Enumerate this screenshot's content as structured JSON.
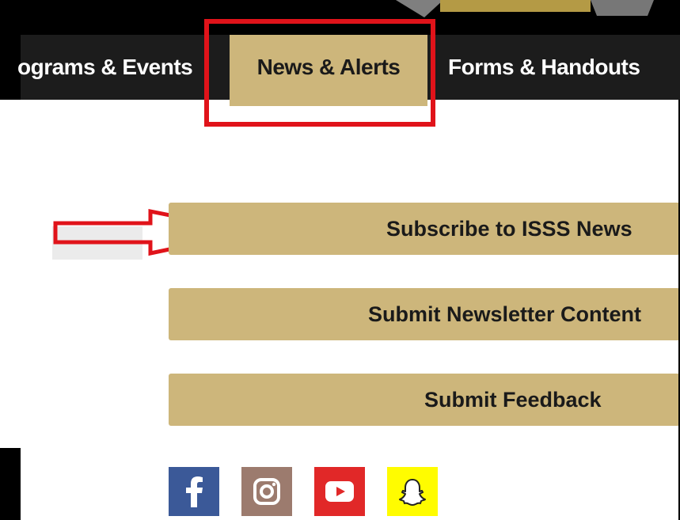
{
  "nav": {
    "tabs": [
      {
        "label": "ograms & Events"
      },
      {
        "label": "News & Alerts",
        "active": true
      },
      {
        "label": "Forms & Handouts"
      }
    ]
  },
  "buttons": {
    "subscribe": "Subscribe to ISSS News",
    "newsletter": "Submit Newsletter Content",
    "feedback": "Submit Feedback"
  },
  "social": [
    {
      "icon": "facebook-icon",
      "color": "#3b5998"
    },
    {
      "icon": "instagram-icon",
      "color": "#9c7b6e"
    },
    {
      "icon": "youtube-icon",
      "color": "#e12828"
    },
    {
      "icon": "snapchat-icon",
      "color": "#fffc00"
    }
  ],
  "colors": {
    "gold": "#cdb67b",
    "nav_bg": "#1c1c1c",
    "highlight_red": "#e0131a"
  }
}
